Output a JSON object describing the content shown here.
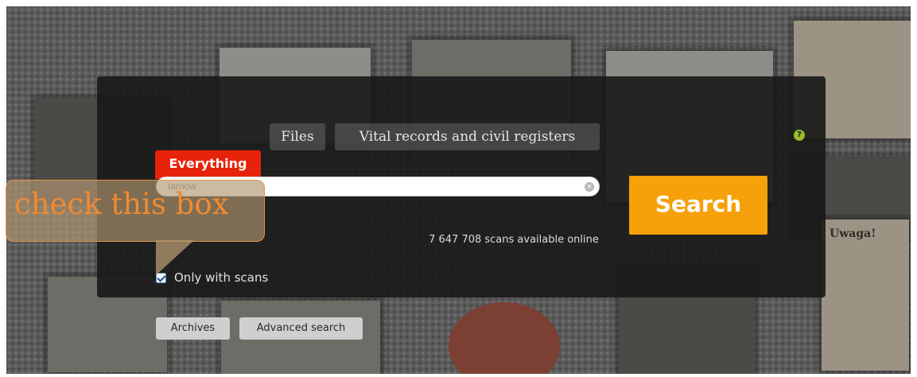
{
  "tabs": {
    "files": "Files",
    "vital_records": "Vital records and civil registers",
    "everything": "Everything"
  },
  "help": {
    "icon": "help-icon",
    "glyph": "?"
  },
  "search": {
    "value": "tarnow",
    "clear_glyph": "⊗",
    "button_label": "Search"
  },
  "status": {
    "scans_available": "7 647 708 scans available online"
  },
  "filters": {
    "only_with_scans_label": "Only with scans",
    "only_with_scans_checked": true
  },
  "footer_links": {
    "archives": "Archives",
    "advanced_search": "Advanced search"
  },
  "annotation": {
    "text": "check this box"
  },
  "background_doc": {
    "text": "Uwaga!"
  },
  "colors": {
    "accent_red": "#e8230b",
    "search_orange": "#f6a00a",
    "help_green": "#98bd2a",
    "callout_orange": "#ef8b32"
  }
}
